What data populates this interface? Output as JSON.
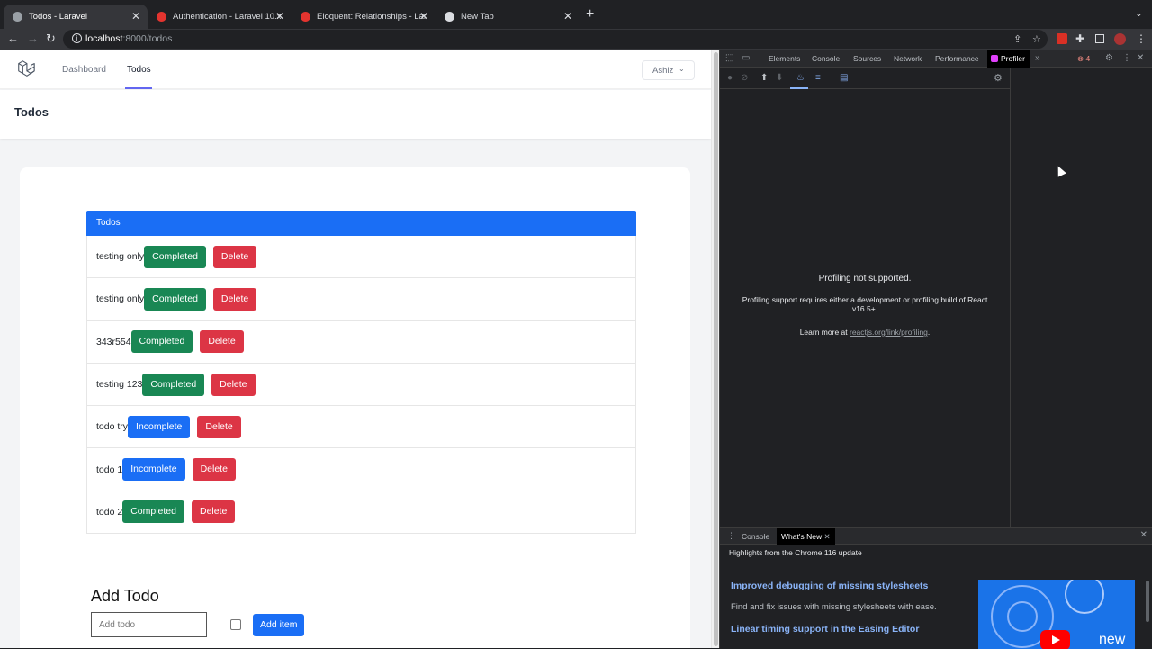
{
  "browser": {
    "tabs": [
      {
        "label": "Todos - Laravel",
        "active": true
      },
      {
        "label": "Authentication - Laravel 10.x -",
        "active": false
      },
      {
        "label": "Eloquent: Relationships - Lara",
        "active": false
      },
      {
        "label": "New Tab",
        "active": false
      }
    ],
    "url_host": "localhost",
    "url_path": ":8000/todos"
  },
  "app": {
    "nav": {
      "dashboard": "Dashboard",
      "todos": "Todos",
      "user": "Ashiz"
    },
    "header_title": "Todos",
    "list_title": "Todos",
    "todos": [
      {
        "text": "testing only",
        "status": "Completed",
        "delete": "Delete"
      },
      {
        "text": "testing only",
        "status": "Completed",
        "delete": "Delete"
      },
      {
        "text": "343r554",
        "status": "Completed",
        "delete": "Delete"
      },
      {
        "text": "testing 123",
        "status": "Completed",
        "delete": "Delete"
      },
      {
        "text": "todo try",
        "status": "Incomplete",
        "delete": "Delete"
      },
      {
        "text": "todo 1",
        "status": "Incomplete",
        "delete": "Delete"
      },
      {
        "text": "todo 2",
        "status": "Completed",
        "delete": "Delete"
      }
    ],
    "add": {
      "title": "Add Todo",
      "placeholder": "Add todo",
      "button": "Add item"
    }
  },
  "devtools": {
    "tabs": [
      "Elements",
      "Console",
      "Sources",
      "Network",
      "Performance",
      "Profiler"
    ],
    "error_count": "4",
    "profiler": {
      "title": "Profiling not supported.",
      "description": "Profiling support requires either a development or profiling build of React v16.5+.",
      "learn_prefix": "Learn more at ",
      "learn_link": "reactjs.org/link/profiling",
      "learn_suffix": "."
    },
    "drawer": {
      "tabs": [
        "Console",
        "What's New"
      ],
      "subtitle": "Highlights from the Chrome 116 update",
      "item1_title": "Improved debugging of missing stylesheets",
      "item1_desc": "Find and fix issues with missing stylesheets with ease.",
      "item2_title": "Linear timing support in the Easing Editor",
      "thumb_text": "new"
    }
  },
  "colors": {
    "primary": "#1a6ef5",
    "success": "#198754",
    "danger": "#dc3545"
  }
}
